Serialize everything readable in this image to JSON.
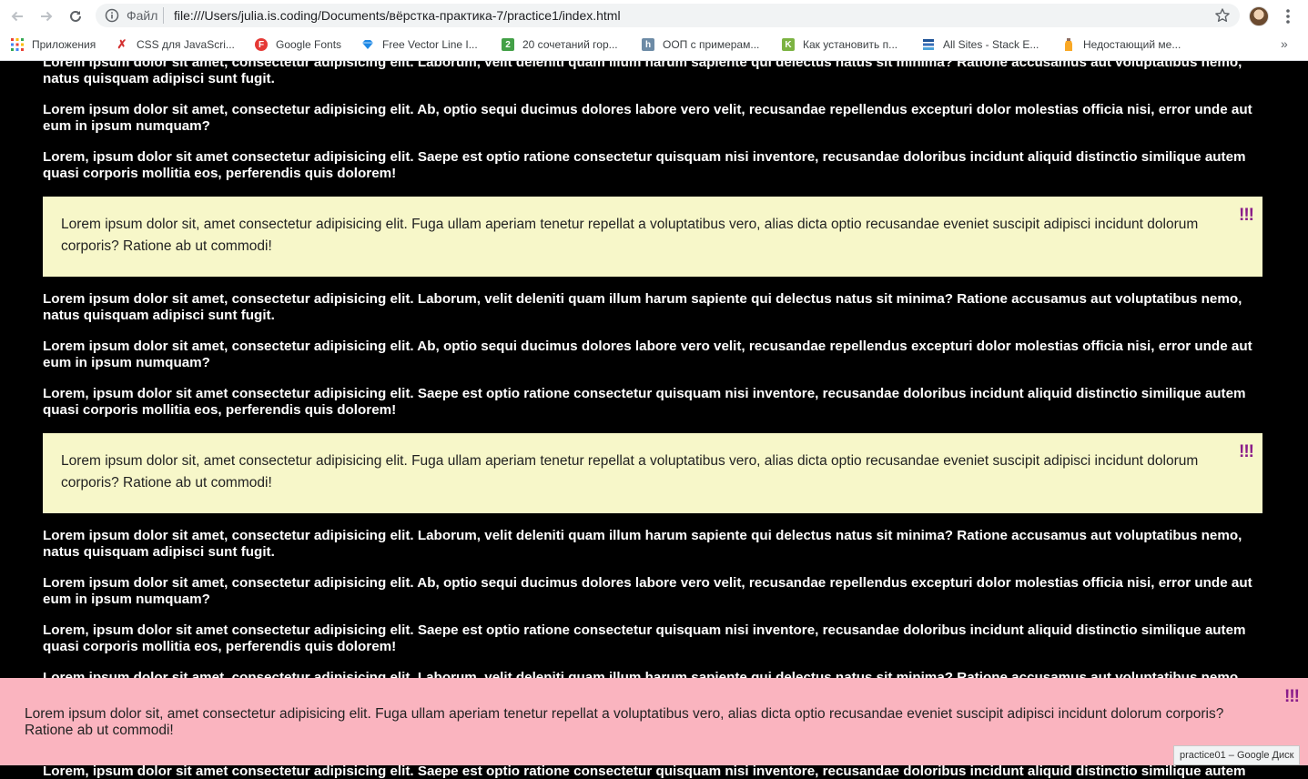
{
  "browser": {
    "scheme_label": "Файл",
    "url": "file:///Users/julia.is.coding/Documents/вёрстка-практика-7/practice1/index.html",
    "bookmarks": [
      {
        "label": "Приложения",
        "icon": "apps-grid-icon"
      },
      {
        "label": "CSS для JavaScri...",
        "icon": "css-js-icon"
      },
      {
        "label": "Google Fonts",
        "icon": "google-fonts-icon"
      },
      {
        "label": "Free Vector Line I...",
        "icon": "diamond-icon"
      },
      {
        "label": "20 сочетаний гор...",
        "icon": "hotkeys-icon"
      },
      {
        "label": "ООП с примерам...",
        "icon": "habr-icon"
      },
      {
        "label": "Как установить п...",
        "icon": "site-icon"
      },
      {
        "label": "All Sites - Stack E...",
        "icon": "stackexchange-icon"
      },
      {
        "label": "Недостающий ме...",
        "icon": "bottle-icon"
      }
    ],
    "more_bookmarks": "»"
  },
  "page": {
    "paragraphs": {
      "p1": "Lorem ipsum dolor sit amet, consectetur adipisicing elit. Laborum, velit deleniti quam illum harum sapiente qui delectus natus sit minima? Ratione accusamus aut voluptatibus nemo, natus quisquam adipisci sunt fugit.",
      "p2": "Lorem ipsum dolor sit amet, consectetur adipisicing elit. Ab, optio sequi ducimus dolores labore vero velit, recusandae repellendus excepturi dolor molestias officia nisi, error unde aut eum in ipsum numquam?",
      "p3": "Lorem, ipsum dolor sit amet consectetur adipisicing elit. Saepe est optio ratione consectetur quisquam nisi inventore, recusandae doloribus incidunt aliquid distinctio similique autem quasi corporis mollitia eos, perferendis quis dolorem!"
    },
    "note_text": "Lorem ipsum dolor sit, amet consectetur adipisicing elit. Fuga ullam aperiam tenetur repellat a voluptatibus vero, alias dicta optio recusandae eveniet suscipit adipisci incidunt dolorum corporis? Ratione ab ut commodi!",
    "note_mark": "!!!",
    "fixed_note_text": "Lorem ipsum dolor sit, amet consectetur adipisicing elit. Fuga ullam aperiam tenetur repellat a voluptatibus vero, alias dicta optio recusandae eveniet suscipit adipisci incidunt dolorum corporis? Ratione ab ut commodi!",
    "fixed_note_mark": "!!!"
  },
  "tooltip": "practice01 – Google Диск",
  "colors": {
    "page_bg": "#000000",
    "note_bg": "#f7f7c9",
    "fixed_note_bg": "#fab4bf",
    "mark": "#8a1c8a"
  }
}
